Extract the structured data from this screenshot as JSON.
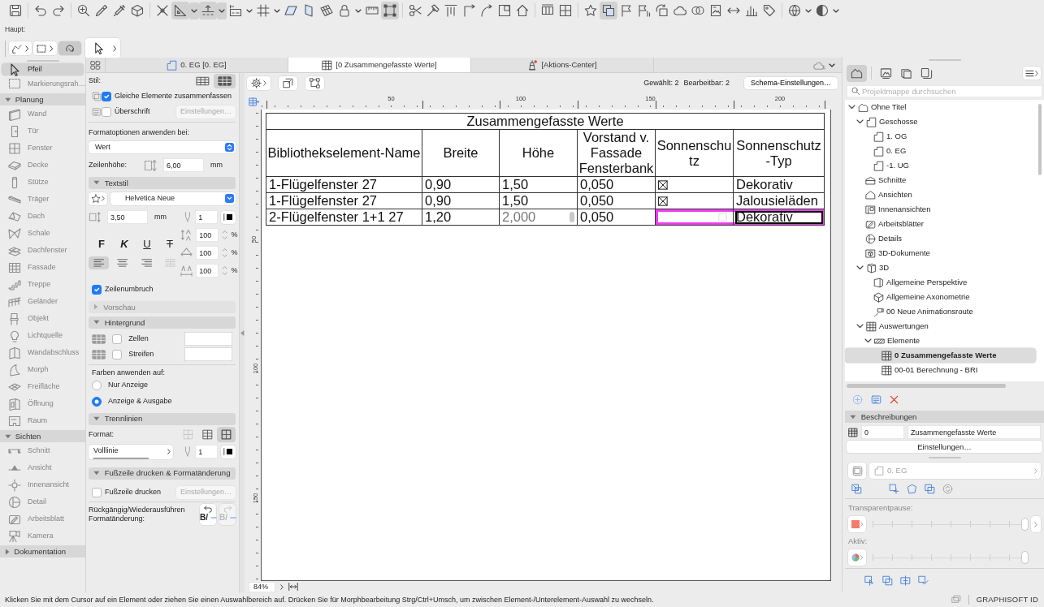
{
  "toolbar": {
    "groups": [
      {
        "buttons": [
          {
            "kind": "save",
            "pressed": false
          }
        ]
      },
      {
        "buttons": [
          {
            "kind": "undo",
            "pressed": false
          },
          {
            "kind": "redo",
            "pressed": false
          }
        ]
      },
      {
        "buttons": [
          {
            "kind": "pickup",
            "pressed": false
          },
          {
            "kind": "eyedropper",
            "pressed": false
          },
          {
            "kind": "syringe",
            "pressed": false
          },
          {
            "kind": "transfer",
            "pressed": false
          }
        ]
      },
      {
        "buttons": [
          {
            "kind": "snap",
            "pressed": false
          },
          {
            "kind": "angle",
            "pressed": true
          },
          {
            "kind": "caret",
            "pressed": true
          },
          {
            "kind": "guide",
            "pressed": true
          },
          {
            "kind": "caret",
            "pressed": true
          },
          {
            "kind": "coordinates",
            "pressed": false
          },
          {
            "kind": "caret",
            "pressed": false
          },
          {
            "kind": "grid",
            "pressed": false
          },
          {
            "kind": "caret",
            "pressed": false
          },
          {
            "kind": "plane",
            "pressed": false
          },
          {
            "kind": "vplane",
            "pressed": false
          },
          {
            "kind": "editplane",
            "pressed": false
          },
          {
            "kind": "lock",
            "pressed": false
          },
          {
            "kind": "caret",
            "pressed": false
          },
          {
            "kind": "ruler",
            "pressed": false
          },
          {
            "kind": "groupsel",
            "pressed": true
          }
        ]
      },
      {
        "buttons": [
          {
            "kind": "trim",
            "pressed": false
          },
          {
            "kind": "hammer",
            "pressed": false
          },
          {
            "kind": "align",
            "pressed": false
          },
          {
            "kind": "corner",
            "pressed": false
          },
          {
            "kind": "curve",
            "pressed": false
          },
          {
            "kind": "boxin",
            "pressed": false
          },
          {
            "kind": "house",
            "pressed": false
          }
        ]
      },
      {
        "buttons": [
          {
            "kind": "split",
            "pressed": false
          },
          {
            "kind": "boxsplit",
            "pressed": false
          }
        ]
      },
      {
        "buttons": [
          {
            "kind": "star",
            "pressed": false
          },
          {
            "kind": "viewsel",
            "pressed": true
          },
          {
            "kind": "flag",
            "pressed": false
          },
          {
            "kind": "flagplus",
            "pressed": false
          },
          {
            "kind": "rotatebox",
            "pressed": false
          },
          {
            "kind": "cloud",
            "pressed": false
          },
          {
            "kind": "circles",
            "pressed": false
          },
          {
            "kind": "docimg",
            "pressed": false
          },
          {
            "kind": "arrows",
            "pressed": false
          },
          {
            "kind": "chart",
            "pressed": false
          },
          {
            "kind": "tag",
            "pressed": false
          }
        ]
      },
      {
        "buttons": [
          {
            "kind": "globe",
            "pressed": false
          },
          {
            "kind": "caret",
            "pressed": false
          },
          {
            "kind": "halfcircle",
            "pressed": false
          },
          {
            "kind": "caret",
            "pressed": false
          }
        ]
      }
    ]
  },
  "haupt": {
    "label": "Haupt:",
    "buttons": [
      {
        "kind": "lasso",
        "pressed": false
      },
      {
        "kind": "marquee",
        "pressed": false
      },
      {
        "kind": "rotate",
        "pressed": true
      },
      {
        "kind": "arrow",
        "pressed": false
      }
    ]
  },
  "toolbox": {
    "items": [
      {
        "kind": "arrow",
        "label": "Pfeil",
        "selected": true,
        "disabled": false
      },
      {
        "kind": "marquee",
        "label": "Markierungsrah…",
        "selected": false,
        "disabled": true
      }
    ],
    "groups": [
      {
        "label": "Planung",
        "expanded": true,
        "items": [
          {
            "kind": "wall",
            "label": "Wand",
            "selected": false,
            "disabled": true
          },
          {
            "kind": "door",
            "label": "Tür",
            "selected": false,
            "disabled": true
          },
          {
            "kind": "window",
            "label": "Fenster",
            "selected": false,
            "disabled": true
          },
          {
            "kind": "slab",
            "label": "Decke",
            "selected": false,
            "disabled": true
          },
          {
            "kind": "column",
            "label": "Stütze",
            "selected": false,
            "disabled": true
          },
          {
            "kind": "beam",
            "label": "Träger",
            "selected": false,
            "disabled": true
          },
          {
            "kind": "roof",
            "label": "Dach",
            "selected": false,
            "disabled": true
          },
          {
            "kind": "shell",
            "label": "Schale",
            "selected": false,
            "disabled": true
          },
          {
            "kind": "skylight",
            "label": "Dachfenster",
            "selected": false,
            "disabled": true
          },
          {
            "kind": "curtainwall",
            "label": "Fassade",
            "selected": false,
            "disabled": true
          },
          {
            "kind": "stair",
            "label": "Treppe",
            "selected": false,
            "disabled": true
          },
          {
            "kind": "railing",
            "label": "Geländer",
            "selected": false,
            "disabled": true
          },
          {
            "kind": "object",
            "label": "Objekt",
            "selected": false,
            "disabled": true
          },
          {
            "kind": "lamp",
            "label": "Lichtquelle",
            "selected": false,
            "disabled": true
          },
          {
            "kind": "wallend",
            "label": "Wandabschluss",
            "selected": false,
            "disabled": true
          },
          {
            "kind": "morph",
            "label": "Morph",
            "selected": false,
            "disabled": true
          },
          {
            "kind": "mesh",
            "label": "Freifläche",
            "selected": false,
            "disabled": true
          },
          {
            "kind": "opening",
            "label": "Öffnung",
            "selected": false,
            "disabled": true
          },
          {
            "kind": "zone",
            "label": "Raum",
            "selected": false,
            "disabled": true
          }
        ]
      },
      {
        "label": "Sichten",
        "expanded": true,
        "items": [
          {
            "kind": "section",
            "label": "Schnitt",
            "selected": false,
            "disabled": true
          },
          {
            "kind": "elevation",
            "label": "Ansicht",
            "selected": false,
            "disabled": true
          },
          {
            "kind": "interior",
            "label": "Innenansicht",
            "selected": false,
            "disabled": true
          },
          {
            "kind": "detail",
            "label": "Detail",
            "selected": false,
            "disabled": true
          },
          {
            "kind": "worksheet",
            "label": "Arbeitsblatt",
            "selected": false,
            "disabled": true
          },
          {
            "kind": "camera",
            "label": "Kamera",
            "selected": false,
            "disabled": true
          }
        ]
      },
      {
        "label": "Dokumentation",
        "expanded": false
      }
    ]
  },
  "tabs": [
    {
      "kind": "story",
      "label": "0. EG [0. EG]",
      "selected": false,
      "alert": false
    },
    {
      "kind": "schedule",
      "label": "[0 Zusammengefasste Werte]",
      "selected": true,
      "alert": false
    },
    {
      "kind": "action",
      "label": "[Aktions-Center]",
      "selected": false,
      "alert": true
    }
  ],
  "settings": {
    "style": {
      "label": "Stil:",
      "options": [
        {
          "selected": false
        },
        {
          "selected": true
        }
      ]
    },
    "merge": {
      "label": "Gleiche Elemente zusammenfassen",
      "checked": true
    },
    "heading": {
      "label": "Überschrift",
      "checked": false,
      "button": {
        "label": "Einstellungen…",
        "disabled": true
      }
    },
    "format_apply": {
      "label": "Formatoptionen anwenden bei:",
      "value": "Wert"
    },
    "row_height": {
      "label": "Zeilenhöhe:",
      "value": "6,00",
      "unit": "mm"
    },
    "text_style": {
      "label": "Textstil",
      "expanded": true,
      "font": "Helvetica Neue",
      "size": "3,50",
      "unit": "mm",
      "pen": "1"
    },
    "text_format": [
      {
        "kind": "bold",
        "label": "F",
        "pressed": false
      },
      {
        "kind": "italic",
        "label": "K",
        "pressed": false
      },
      {
        "kind": "underline",
        "label": "U",
        "pressed": false
      },
      {
        "kind": "strike",
        "label": "T",
        "pressed": false
      }
    ],
    "alignment": [
      {
        "kind": "left",
        "selected": true,
        "disabled": false
      },
      {
        "kind": "center",
        "selected": false,
        "disabled": false
      },
      {
        "kind": "right",
        "selected": false,
        "disabled": false
      },
      {
        "kind": "justify",
        "selected": false,
        "disabled": true
      }
    ],
    "scales": [
      {
        "kind": "spacing",
        "value": "100",
        "unit": "%"
      },
      {
        "kind": "width",
        "value": "100",
        "unit": "%"
      },
      {
        "kind": "letter",
        "value": "100",
        "unit": "%"
      }
    ],
    "wrap": {
      "label": "Zeilenumbruch",
      "checked": true
    },
    "preview": {
      "label": "Vorschau",
      "expanded": false,
      "disabled": true
    },
    "background": {
      "label": "Hintergrund",
      "expanded": true,
      "rows": [
        {
          "label": "Zellen",
          "checked": false
        },
        {
          "label": "Streifen",
          "checked": false
        }
      ]
    },
    "apply_colors": {
      "label": "Farben anwenden auf:",
      "options": [
        {
          "label": "Nur Anzeige",
          "selected": false
        },
        {
          "label": "Anzeige & Ausgabe",
          "selected": true
        }
      ]
    },
    "separators": {
      "label": "Trennlinien",
      "expanded": true,
      "format_label": "Format:",
      "formats": [
        {
          "selected": false,
          "disabled": true
        },
        {
          "selected": false,
          "disabled": false
        },
        {
          "selected": true,
          "disabled": false
        }
      ],
      "line": "Volllinie",
      "pen": "1"
    },
    "footer": {
      "label": "Fußzeile drucken & Formatänderung",
      "expanded": true,
      "checkbox": {
        "label": "Fußzeile drucken",
        "checked": false
      },
      "button": {
        "label": "Einstellungen…",
        "disabled": true
      }
    },
    "undo": {
      "label": "Rückgängig/Wiederausführen Formatänderung:",
      "buttons": [
        {
          "kind": "undo",
          "glyph": "B/",
          "disabled": false
        },
        {
          "kind": "redo",
          "glyph": "B/",
          "disabled": true
        }
      ]
    }
  },
  "view": {
    "selection": "Gewählt: 2",
    "editable": "Bearbeitbar: 2",
    "settings_button": "Schema-Einstellungen…",
    "ruler_labels": [
      "50",
      "100",
      "150",
      "200"
    ],
    "vruler_labels": [
      "50",
      "100",
      "150"
    ],
    "table": {
      "title": "Zusammengefasste Werte",
      "columns": [
        "Bibliothekselement-Name",
        "Breite",
        "Höhe",
        "Vorstand v. Fassade Fensterbank",
        "Sonnenschutz",
        "Sonnenschutz-Typ"
      ],
      "rows": [
        {
          "cells": [
            {
              "kind": "text",
              "text": "1-Flügelfenster 27",
              "selected": false,
              "editing": false,
              "highlighted": false
            },
            {
              "kind": "text",
              "text": "0,90",
              "selected": false,
              "editing": false,
              "highlighted": false
            },
            {
              "kind": "text",
              "text": "1,50",
              "selected": false,
              "editing": false,
              "highlighted": false
            },
            {
              "kind": "text",
              "text": "0,050",
              "selected": false,
              "editing": false,
              "highlighted": false
            },
            {
              "kind": "checkbox",
              "checked": true,
              "selected": false,
              "editing": false,
              "highlighted": false
            },
            {
              "kind": "text",
              "text": "Dekorativ",
              "selected": false,
              "editing": false,
              "highlighted": false
            }
          ]
        },
        {
          "cells": [
            {
              "kind": "text",
              "text": "1-Flügelfenster 27",
              "selected": false,
              "editing": false,
              "highlighted": false
            },
            {
              "kind": "text",
              "text": "0,90",
              "selected": false,
              "editing": false,
              "highlighted": false
            },
            {
              "kind": "text",
              "text": "1,50",
              "selected": false,
              "editing": false,
              "highlighted": false
            },
            {
              "kind": "text",
              "text": "0,050",
              "selected": false,
              "editing": false,
              "highlighted": false
            },
            {
              "kind": "checkbox",
              "checked": true,
              "selected": false,
              "editing": false,
              "highlighted": false
            },
            {
              "kind": "text",
              "text": "Jalousieläden",
              "selected": false,
              "editing": false,
              "highlighted": false
            }
          ]
        },
        {
          "cells": [
            {
              "kind": "text",
              "text": "2-Flügelfenster 1+1 27",
              "selected": false,
              "editing": false,
              "highlighted": false
            },
            {
              "kind": "text",
              "text": "1,20",
              "selected": false,
              "editing": false,
              "highlighted": false
            },
            {
              "kind": "text",
              "text": "2,000",
              "selected": false,
              "editing": true,
              "highlighted": false
            },
            {
              "kind": "text",
              "text": "0,050",
              "selected": false,
              "editing": false,
              "highlighted": false
            },
            {
              "kind": "checkbox",
              "checked": false,
              "selected": false,
              "editing": false,
              "highlighted": true
            },
            {
              "kind": "text",
              "text": "Dekorativ",
              "selected": true,
              "editing": false,
              "highlighted": true
            }
          ]
        }
      ]
    },
    "zoom": "84%"
  },
  "navigator": {
    "tabs": [
      {
        "kind": "project",
        "selected": true
      },
      {
        "kind": "views",
        "selected": false
      },
      {
        "kind": "layouts",
        "selected": false
      },
      {
        "kind": "publisher",
        "selected": false
      }
    ],
    "search": {
      "placeholder": "Projektmappe durchsuchen"
    },
    "tree": [
      {
        "kind": "project",
        "label": "Ohne Titel",
        "expanded": true,
        "selected": false,
        "children": [
          {
            "kind": "stories",
            "label": "Geschosse",
            "expanded": true,
            "selected": false,
            "children": [
              {
                "kind": "story",
                "label": "1. OG",
                "selected": false
              },
              {
                "kind": "story",
                "label": "0. EG",
                "selected": false
              },
              {
                "kind": "story",
                "label": "-1. UG",
                "selected": false
              }
            ]
          },
          {
            "kind": "sections",
            "label": "Schnitte",
            "selected": false
          },
          {
            "kind": "elevations",
            "label": "Ansichten",
            "selected": false
          },
          {
            "kind": "interiors",
            "label": "Innenansichten",
            "selected": false
          },
          {
            "kind": "worksheets",
            "label": "Arbeitsblätter",
            "selected": false
          },
          {
            "kind": "details",
            "label": "Details",
            "selected": false
          },
          {
            "kind": "documents3d",
            "label": "3D-Dokumente",
            "selected": false
          },
          {
            "kind": "folder3d",
            "label": "3D",
            "expanded": true,
            "selected": false,
            "children": [
              {
                "kind": "perspective",
                "label": "Allgemeine Perspektive",
                "selected": false
              },
              {
                "kind": "axonometry",
                "label": "Allgemeine Axonometrie",
                "selected": false
              },
              {
                "kind": "animation",
                "label": "00 Neue Animationsroute",
                "selected": false
              }
            ]
          },
          {
            "kind": "schedules",
            "label": "Auswertungen",
            "expanded": true,
            "selected": false,
            "children": [
              {
                "kind": "elements",
                "label": "Elemente",
                "expanded": true,
                "selected": false,
                "children": [
                  {
                    "kind": "schedule",
                    "label": "0 Zusammengefasste Werte",
                    "selected": true
                  },
                  {
                    "kind": "schedule",
                    "label": "00-01 Berechnung - BRI",
                    "selected": false
                  }
                ]
              }
            ]
          }
        ]
      }
    ],
    "descriptions": {
      "label": "Beschreibungen",
      "expanded": true,
      "id": "0",
      "name": "Zusammengefasste Werte",
      "button": "Einstellungen…"
    },
    "story": {
      "value": "0. EG",
      "disabled": true
    },
    "trace": {
      "label": "Transparentpause:",
      "level": 1
    },
    "active": {
      "label": "Aktiv:",
      "level": 1
    }
  },
  "status_bar": {
    "message": "Klicken Sie mit dem Cursor auf ein Element oder ziehen Sie einen Auswahlbereich auf. Drücken Sie für Morphbearbeitung Strg/Ctrl+Umsch, um zwischen Element-/Unterelement-Auswahl zu wechseln.",
    "brand": "GRAPHISOFT ID"
  }
}
